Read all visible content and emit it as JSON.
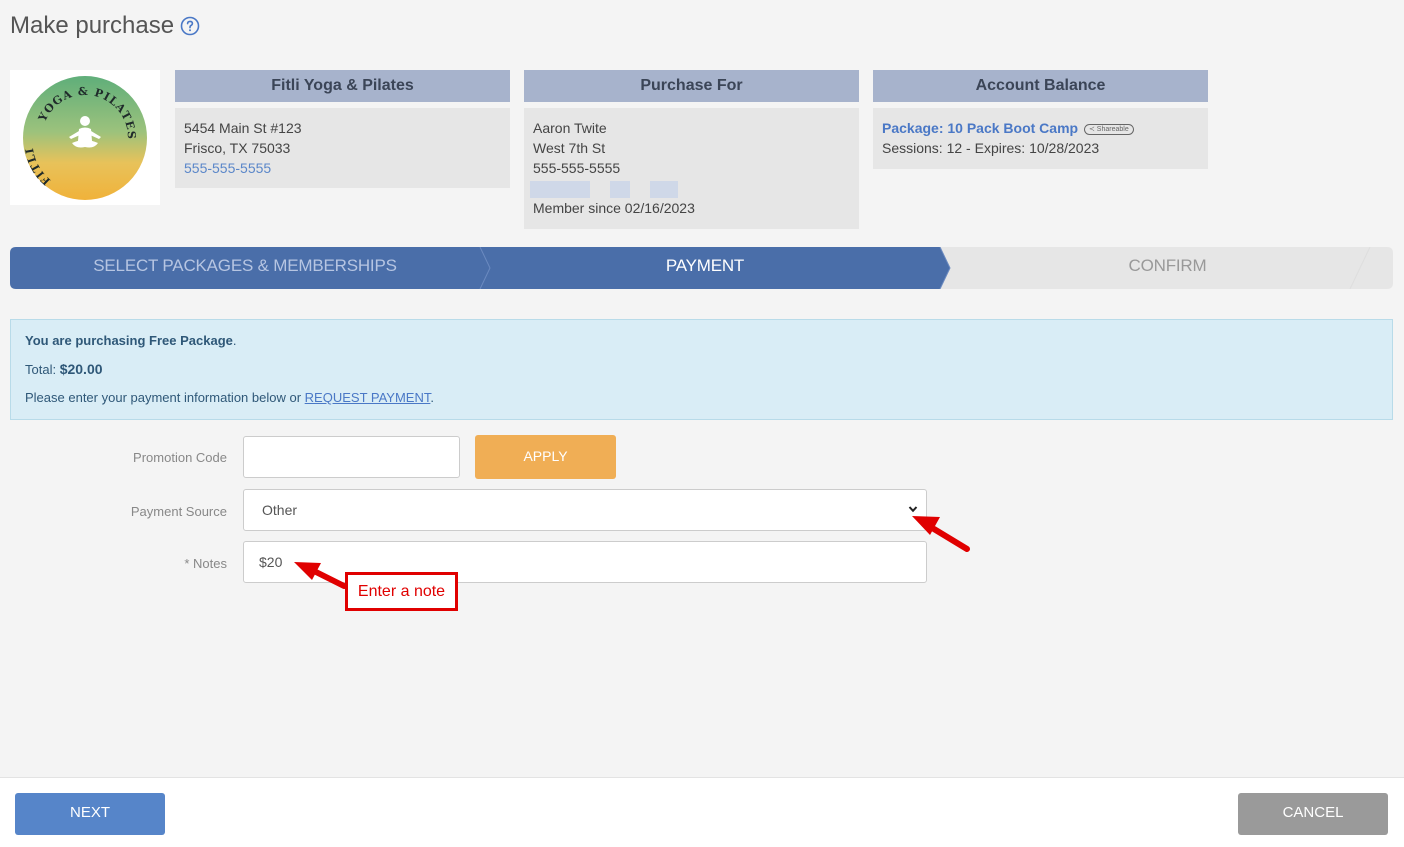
{
  "page": {
    "title": "Make purchase"
  },
  "logo": {
    "text_top": "YOGA & PILATES",
    "text_left": "FITLI"
  },
  "business": {
    "header": "Fitli Yoga & Pilates",
    "address_line1": "5454 Main St #123",
    "address_line2": "Frisco, TX 75033",
    "phone": "555-555-5555"
  },
  "purchase_for": {
    "header": "Purchase For",
    "name": "Aaron Twite",
    "street": "West 7th St",
    "phone": "555-555-5555",
    "member_since": "Member since 02/16/2023"
  },
  "account_balance": {
    "header": "Account Balance",
    "package_label": "Package: 10 Pack Boot Camp",
    "badge": "Shareable",
    "sessions": "Sessions: 12 -",
    "expires": "Expires: 10/28/2023"
  },
  "stepper": {
    "steps": [
      {
        "label": "SELECT PACKAGES & MEMBERSHIPS",
        "state": "completed"
      },
      {
        "label": "PAYMENT",
        "state": "active"
      },
      {
        "label": "CONFIRM",
        "state": "pending"
      }
    ]
  },
  "alert": {
    "purchasing_prefix": "You are purchasing",
    "package_name": "Free Package",
    "purchasing_suffix": ".",
    "total_label": "Total:",
    "total_value": "$20.00",
    "payment_text": "Please enter your payment information below or",
    "request_link": "REQUEST PAYMENT",
    "payment_suffix": "."
  },
  "form": {
    "promo_label": "Promotion Code",
    "promo_value": "",
    "apply_label": "APPLY",
    "source_label": "Payment Source",
    "source_value": "Other",
    "notes_label": "* Notes",
    "notes_value": "$20"
  },
  "annotation": {
    "callout_text": "Enter a note"
  },
  "footer": {
    "next_label": "NEXT",
    "cancel_label": "CANCEL"
  },
  "colors": {
    "primary": "#5685c9",
    "stepper_active": "#4a6ea9",
    "apply": "#f0ae55",
    "alert_bg": "#d9edf6",
    "annotation_red": "#e00000"
  }
}
